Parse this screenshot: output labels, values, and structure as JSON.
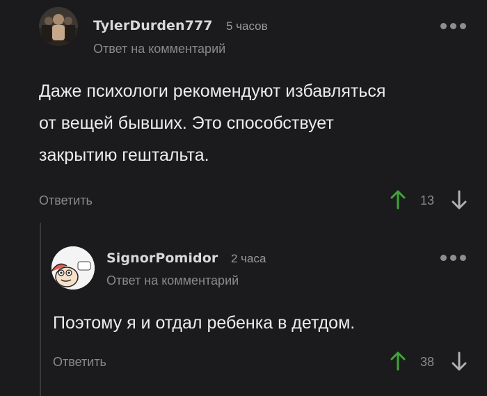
{
  "comments": [
    {
      "author": "TylerDurden777",
      "time": "5 часов",
      "reply_meta": "Ответ на комментарий",
      "text_lines": [
        "Даже психологи рекомендуют избавляться",
        "от вещей бывших. Это способствует",
        "закрытию гештальта."
      ],
      "reply_label": "Ответить",
      "score": "13",
      "avatar_icon": "avatar-photo",
      "menu_icon": "more-dots-icon"
    },
    {
      "author": "SignorPomidor",
      "time": "2 часа",
      "reply_meta": "Ответ на комментарий",
      "text_lines": [
        "Поэтому я и отдал ребенка в детдом."
      ],
      "reply_label": "Ответить",
      "score": "38",
      "avatar_icon": "avatar-cartoon",
      "menu_icon": "more-dots-icon"
    }
  ],
  "colors": {
    "background": "#1b1b1d",
    "upvote": "#3fa535",
    "downvote": "#b0b0b0",
    "meta": "#8a8a8a"
  }
}
